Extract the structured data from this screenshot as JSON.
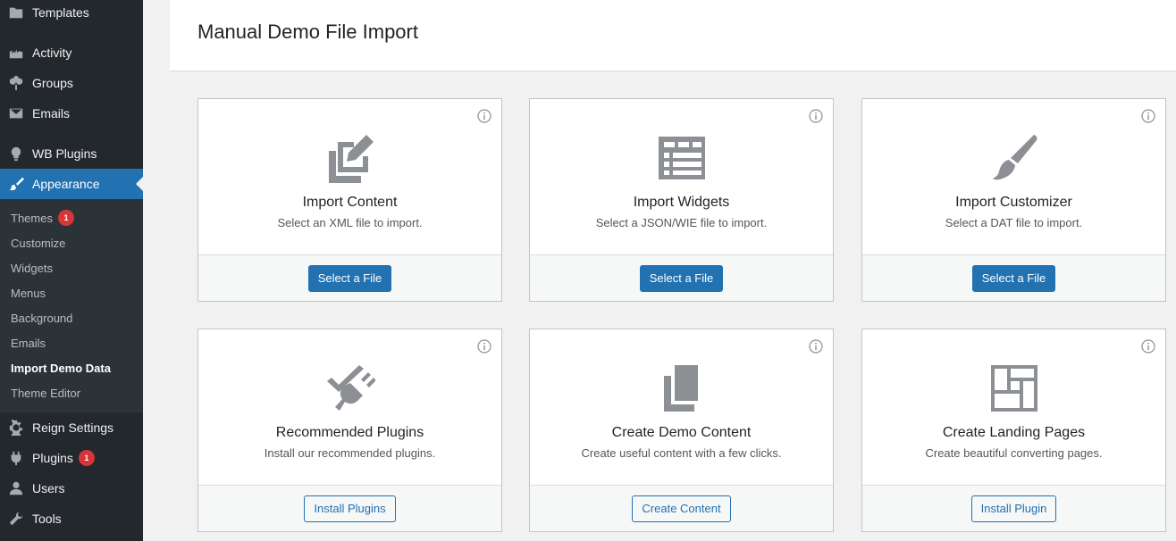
{
  "sidebar": {
    "items": [
      {
        "label": "Templates",
        "icon": "folder-icon"
      },
      {
        "label": "Activity",
        "icon": "activity-icon"
      },
      {
        "label": "Groups",
        "icon": "groups-icon"
      },
      {
        "label": "Emails",
        "icon": "email-icon"
      },
      {
        "label": "WB Plugins",
        "icon": "lightbulb-icon"
      },
      {
        "label": "Appearance",
        "icon": "paintbrush-icon"
      },
      {
        "label": "Reign Settings",
        "icon": "gear-icon"
      },
      {
        "label": "Plugins",
        "icon": "plugin-icon",
        "badge": "1"
      },
      {
        "label": "Users",
        "icon": "user-icon"
      },
      {
        "label": "Tools",
        "icon": "wrench-icon"
      }
    ],
    "submenu": [
      {
        "label": "Themes",
        "badge": "1"
      },
      {
        "label": "Customize"
      },
      {
        "label": "Widgets"
      },
      {
        "label": "Menus"
      },
      {
        "label": "Background"
      },
      {
        "label": "Emails"
      },
      {
        "label": "Import Demo Data"
      },
      {
        "label": "Theme Editor"
      }
    ]
  },
  "page": {
    "title": "Manual Demo File Import"
  },
  "cards": [
    {
      "title": "Import Content",
      "description": "Select an XML file to import.",
      "button": "Select a File",
      "icon": "import-content-icon"
    },
    {
      "title": "Import Widgets",
      "description": "Select a JSON/WIE file to import.",
      "button": "Select a File",
      "icon": "widgets-icon"
    },
    {
      "title": "Import Customizer",
      "description": "Select a DAT file to import.",
      "button": "Select a File",
      "icon": "brush-icon"
    },
    {
      "title": "Recommended Plugins",
      "description": "Install our recommended plugins.",
      "button": "Install Plugins",
      "icon": "plugin-check-icon"
    },
    {
      "title": "Create Demo Content",
      "description": "Create useful content with a few clicks.",
      "button": "Create Content",
      "icon": "copy-pages-icon"
    },
    {
      "title": "Create Landing Pages",
      "description": "Create beautiful converting pages.",
      "button": "Install Plugin",
      "icon": "layout-icon"
    }
  ],
  "colors": {
    "sidebar_bg": "#23282d",
    "submenu_bg": "#2c3338",
    "accent": "#2271b1",
    "badge": "#d63638"
  }
}
